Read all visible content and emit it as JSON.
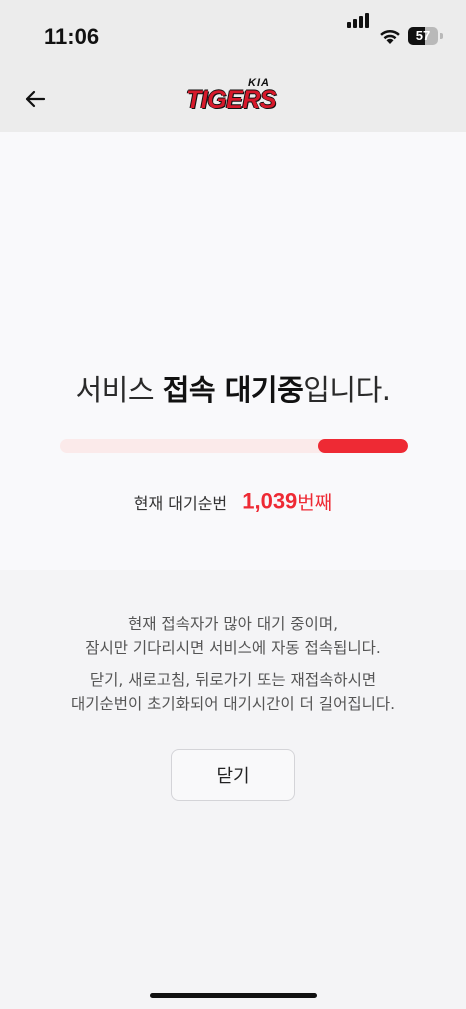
{
  "status_bar": {
    "time": "11:06",
    "battery_level": "57",
    "battery_percent": 57,
    "icons": [
      "signal-icon",
      "wifi-icon",
      "battery-icon"
    ]
  },
  "header": {
    "back_icon": "arrow-left-icon",
    "logo": {
      "brand": "KIA",
      "team": "TIGERS",
      "color": "#d7192b"
    }
  },
  "queue": {
    "title_prefix": "서비스 ",
    "title_bold": "접속 대기중",
    "title_suffix": "입니다.",
    "progress_segment": [
      0.74,
      1.0
    ],
    "current_label": "현재 대기순번",
    "position": "1,039",
    "position_unit": "번째",
    "accent_color": "#ee2a34"
  },
  "notice": {
    "line1": "현재 접속자가 많아 대기 중이며,",
    "line2": "잠시만 기다리시면 서비스에 자동 접속됩니다.",
    "line3": "닫기, 새로고침, 뒤로가기 또는 재접속하시면",
    "line4": "대기순번이 초기화되어 대기시간이 더 길어집니다."
  },
  "actions": {
    "close_label": "닫기"
  }
}
